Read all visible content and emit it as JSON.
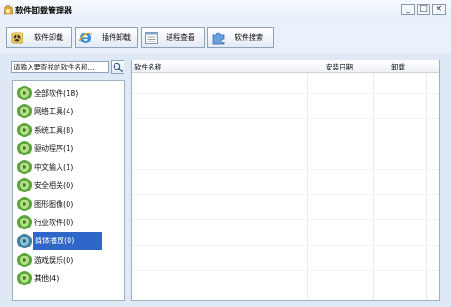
{
  "window": {
    "title": "软件卸载管理器",
    "controls": {
      "minimize": "_",
      "maximize": "□",
      "close": "×"
    }
  },
  "toolbar": {
    "buttons": [
      {
        "label": "软件卸载",
        "icon": "uninstall-icon"
      },
      {
        "label": "插件卸载",
        "icon": "ie-plugin-icon"
      },
      {
        "label": "进程查看",
        "icon": "process-list-icon"
      },
      {
        "label": "软件搜索",
        "icon": "puzzle-search-icon"
      }
    ]
  },
  "search": {
    "placeholder": "请输入要查找的软件名称..."
  },
  "categories": [
    {
      "label": "全部软件(18)"
    },
    {
      "label": "网络工具(4)"
    },
    {
      "label": "系统工具(8)"
    },
    {
      "label": "驱动程序(1)"
    },
    {
      "label": "中文输入(1)"
    },
    {
      "label": "安全相关(0)"
    },
    {
      "label": "图形图像(0)"
    },
    {
      "label": "行业软件(0)"
    },
    {
      "label": "媒体播放(0)",
      "selected": true
    },
    {
      "label": "游戏娱乐(0)"
    },
    {
      "label": "其他(4)"
    }
  ],
  "table": {
    "columns": [
      "软件名称",
      "安装日期",
      "卸载"
    ],
    "rows": []
  },
  "colors": {
    "selection": "#2f67c8",
    "category_icon_green": "#5aa63a",
    "category_icon_selected": "#3d7fa0"
  }
}
